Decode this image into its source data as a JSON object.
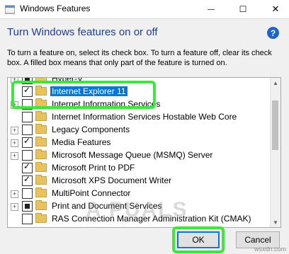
{
  "window": {
    "title": "Windows Features",
    "minimize_glyph": "—",
    "maximize_glyph": "☐",
    "close_glyph": "✕"
  },
  "help_glyph": "?",
  "heading": "Turn Windows features on or off",
  "description": "To turn a feature on, select its check box. To turn a feature off, clear its check box. A filled box means that only part of the feature is turned on.",
  "features": [
    {
      "label": "Hyper-V",
      "expandable": true,
      "state": "partial",
      "selected": false
    },
    {
      "label": "Internet Explorer 11",
      "expandable": false,
      "state": "checked",
      "selected": true
    },
    {
      "label": "Internet Information Services",
      "expandable": true,
      "state": "unchecked",
      "selected": false
    },
    {
      "label": "Internet Information Services Hostable Web Core",
      "expandable": false,
      "state": "unchecked",
      "selected": false
    },
    {
      "label": "Legacy Components",
      "expandable": true,
      "state": "unchecked",
      "selected": false
    },
    {
      "label": "Media Features",
      "expandable": true,
      "state": "checked",
      "selected": false
    },
    {
      "label": "Microsoft Message Queue (MSMQ) Server",
      "expandable": true,
      "state": "unchecked",
      "selected": false
    },
    {
      "label": "Microsoft Print to PDF",
      "expandable": false,
      "state": "checked",
      "selected": false
    },
    {
      "label": "Microsoft XPS Document Writer",
      "expandable": false,
      "state": "checked",
      "selected": false
    },
    {
      "label": "MultiPoint Connector",
      "expandable": true,
      "state": "unchecked",
      "selected": false
    },
    {
      "label": "Print and Document Services",
      "expandable": true,
      "state": "partial",
      "selected": false
    },
    {
      "label": "RAS Connection Manager Administration Kit (CMAK)",
      "expandable": false,
      "state": "unchecked",
      "selected": false
    }
  ],
  "buttons": {
    "ok": "OK",
    "cancel": "Cancel"
  },
  "watermark": "A PUALS",
  "site_credit": "wsxdn.com",
  "colors": {
    "highlight": "#3ee63e",
    "selection": "#0078d7",
    "heading": "#1e3f8f"
  }
}
